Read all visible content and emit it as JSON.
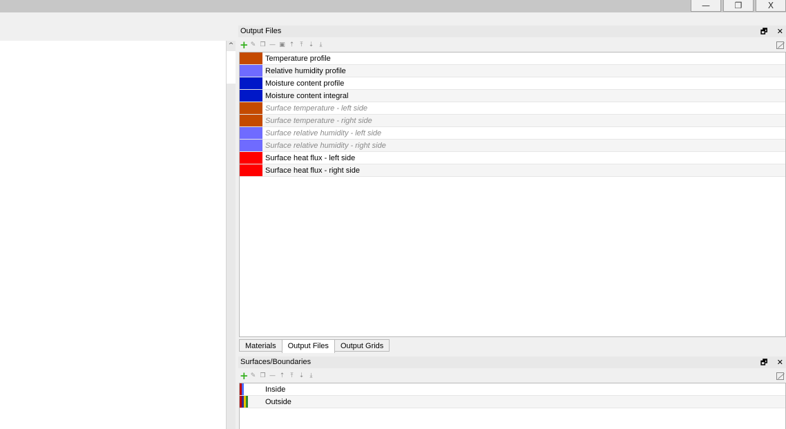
{
  "window": {
    "minimize_glyph": "—",
    "restore_glyph": "❐",
    "close_glyph": "X"
  },
  "output_files_panel": {
    "title": "Output Files",
    "float_glyph": "🗗",
    "close_glyph": "✕",
    "items": [
      {
        "label": "Temperature profile",
        "color": "#c44a00",
        "active": true
      },
      {
        "label": "Relative humidity profile",
        "color": "#6f6bff",
        "active": true
      },
      {
        "label": "Moisture content profile",
        "color": "#0018c8",
        "active": true
      },
      {
        "label": "Moisture content integral",
        "color": "#0018c8",
        "active": true
      },
      {
        "label": "Surface temperature - left side",
        "color": "#c44a00",
        "active": false
      },
      {
        "label": "Surface temperature - right side",
        "color": "#c44a00",
        "active": false
      },
      {
        "label": "Surface relative humidity - left side",
        "color": "#6f6bff",
        "active": false
      },
      {
        "label": "Surface relative humidity - right side",
        "color": "#6f6bff",
        "active": false
      },
      {
        "label": "Surface heat flux - left side",
        "color": "#ff0000",
        "active": true
      },
      {
        "label": "Surface heat flux - right side",
        "color": "#ff0000",
        "active": true
      }
    ]
  },
  "tabs": [
    {
      "label": "Materials",
      "active": false
    },
    {
      "label": "Output Files",
      "active": true
    },
    {
      "label": "Output Grids",
      "active": false
    }
  ],
  "surfaces_panel": {
    "title": "Surfaces/Boundaries",
    "float_glyph": "🗗",
    "close_glyph": "✕",
    "items": [
      {
        "label": "Inside",
        "bars": [
          "#c00000",
          "#4d6bff"
        ]
      },
      {
        "label": "Outside",
        "bars": [
          "#c00000",
          "#3b2a8c",
          "#e8c400",
          "#2e8b2e"
        ]
      }
    ]
  }
}
